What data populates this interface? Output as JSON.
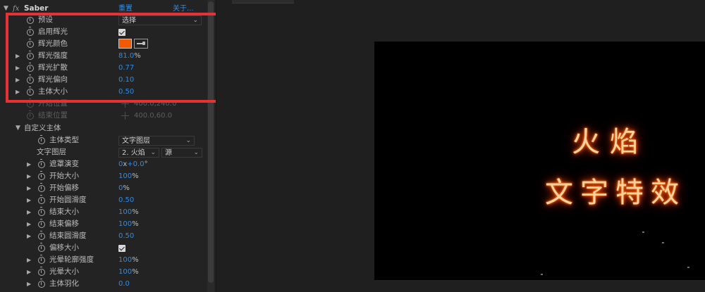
{
  "effect": {
    "name": "Saber",
    "reset_label": "重置",
    "about_label": "关于..."
  },
  "properties": [
    {
      "label": "预设",
      "kind": "dropdown",
      "value": "选择"
    },
    {
      "label": "启用辉光",
      "kind": "checkbox",
      "checked": true
    },
    {
      "label": "辉光颜色",
      "kind": "color",
      "color": "#f15a00"
    },
    {
      "label": "辉光强度",
      "kind": "number",
      "value": "81.0",
      "unit": "%"
    },
    {
      "label": "辉光扩散",
      "kind": "number",
      "value": "0.77"
    },
    {
      "label": "辉光偏向",
      "kind": "number",
      "value": "0.10"
    },
    {
      "label": "主体大小",
      "kind": "number",
      "value": "0.50"
    },
    {
      "label": "开始位置",
      "kind": "point",
      "value": "400.0,240.0",
      "disabled": true
    },
    {
      "label": "结束位置",
      "kind": "point",
      "value": "400.0,60.0",
      "disabled": true
    }
  ],
  "custom_core": {
    "group_label": "自定义主体",
    "core_type": {
      "label": "主体类型",
      "value": "文字图层"
    },
    "text_layer": {
      "label": "文字图层",
      "layer_value": "2.  火焰",
      "source_value": "源"
    },
    "items": [
      {
        "label": "遮罩演变",
        "value": "0",
        "value2": "+0.0",
        "unit": "x",
        "unit2": "°"
      },
      {
        "label": "开始大小",
        "value": "100",
        "unit": "%"
      },
      {
        "label": "开始偏移",
        "value": "0",
        "unit": "%"
      },
      {
        "label": "开始圆滑度",
        "value": "0.50"
      },
      {
        "label": "结束大小",
        "value": "100",
        "unit": "%"
      },
      {
        "label": "结束偏移",
        "value": "100",
        "unit": "%"
      },
      {
        "label": "结束圆滑度",
        "value": "0.50"
      },
      {
        "label": "偏移大小",
        "kind": "checkbox",
        "checked": true
      },
      {
        "label": "光晕轮廓强度",
        "value": "100",
        "unit": "%"
      },
      {
        "label": "光晕大小",
        "value": "100",
        "unit": "%"
      },
      {
        "label": "主体羽化",
        "value": "0.0"
      }
    ]
  },
  "preview": {
    "line1": "火焰",
    "line2": "文字特效"
  },
  "colors": {
    "accent_blue": "#2d8ceb",
    "highlight_red": "#e63234",
    "glow_orange": "#ff5a00"
  }
}
